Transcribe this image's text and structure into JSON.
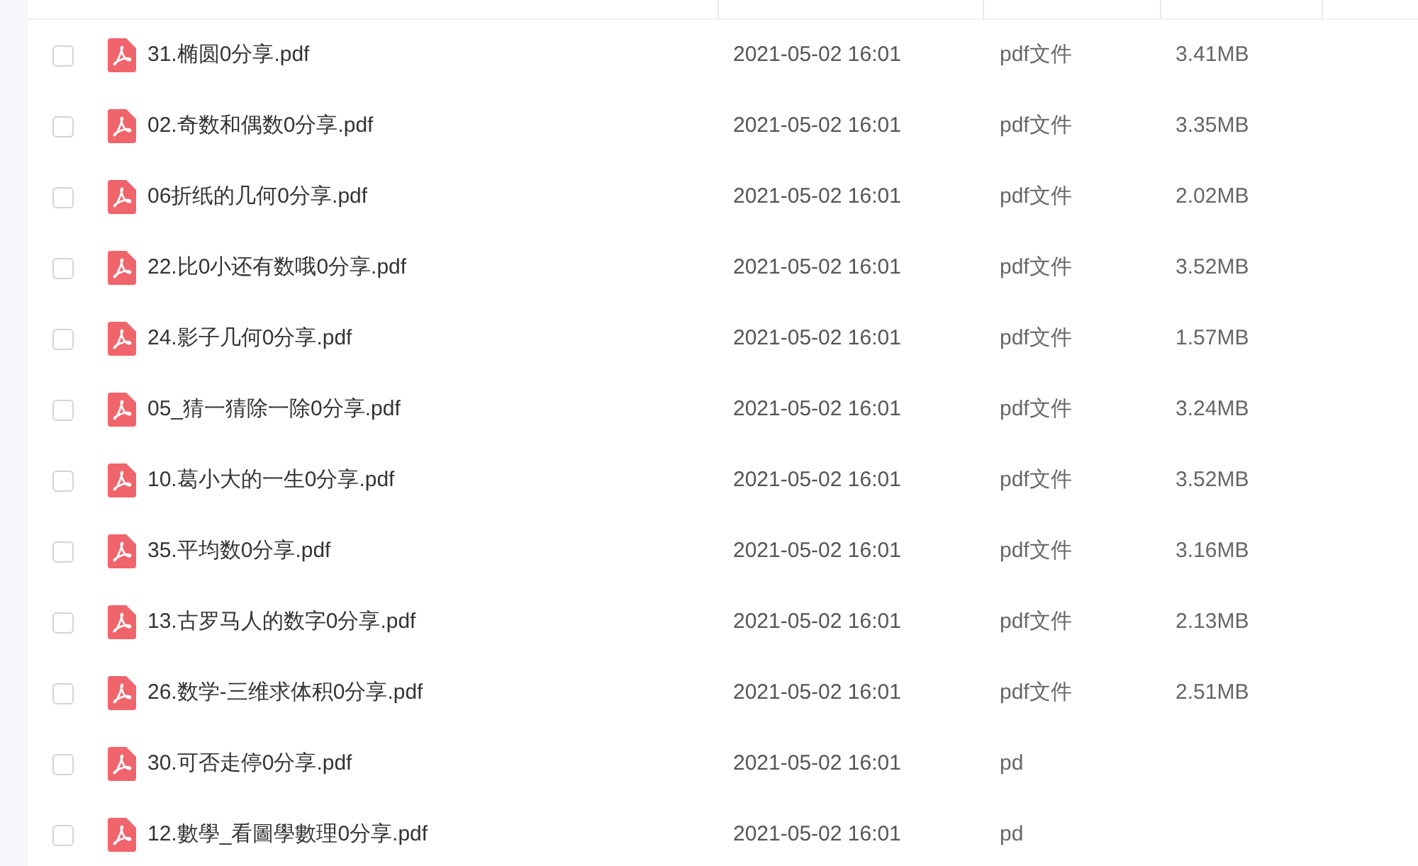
{
  "files": [
    {
      "name": "31.椭圆0分享.pdf",
      "modified": "2021-05-02 16:01",
      "type": "pdf文件",
      "size": "3.41MB",
      "checked": false
    },
    {
      "name": "02.奇数和偶数0分享.pdf",
      "modified": "2021-05-02 16:01",
      "type": "pdf文件",
      "size": "3.35MB",
      "checked": false
    },
    {
      "name": "06折纸的几何0分享.pdf",
      "modified": "2021-05-02 16:01",
      "type": "pdf文件",
      "size": "2.02MB",
      "checked": false
    },
    {
      "name": "22.比0小还有数哦0分享.pdf",
      "modified": "2021-05-02 16:01",
      "type": "pdf文件",
      "size": "3.52MB",
      "checked": false
    },
    {
      "name": "24.影子几何0分享.pdf",
      "modified": "2021-05-02 16:01",
      "type": "pdf文件",
      "size": "1.57MB",
      "checked": false
    },
    {
      "name": "05_猜一猜除一除0分享.pdf",
      "modified": "2021-05-02 16:01",
      "type": "pdf文件",
      "size": "3.24MB",
      "checked": false
    },
    {
      "name": "10.葛小大的一生0分享.pdf",
      "modified": "2021-05-02 16:01",
      "type": "pdf文件",
      "size": "3.52MB",
      "checked": false
    },
    {
      "name": "35.平均数0分享.pdf",
      "modified": "2021-05-02 16:01",
      "type": "pdf文件",
      "size": "3.16MB",
      "checked": false
    },
    {
      "name": "13.古罗马人的数字0分享.pdf",
      "modified": "2021-05-02 16:01",
      "type": "pdf文件",
      "size": "2.13MB",
      "checked": false
    },
    {
      "name": "26.数学-三维求体积0分享.pdf",
      "modified": "2021-05-02 16:01",
      "type": "pdf文件",
      "size": "2.51MB",
      "checked": false
    },
    {
      "name": "30.可否走停0分享.pdf",
      "modified": "2021-05-02 16:01",
      "type": "pd",
      "checked": false
    },
    {
      "name": "12.數學_看圖學數理0分享.pdf",
      "modified": "2021-05-02 16:01",
      "type": "pd",
      "checked": false
    }
  ]
}
